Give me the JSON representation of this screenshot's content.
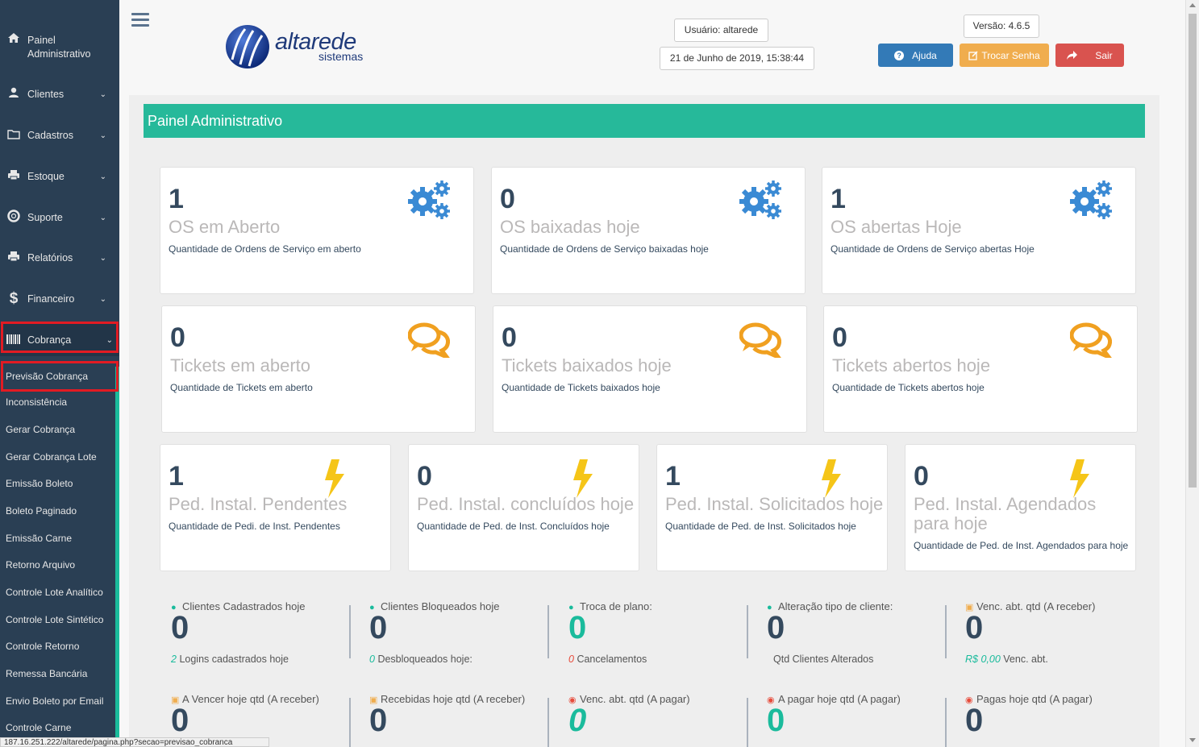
{
  "sidebar": {
    "home": "Painel Administrativo",
    "items": [
      {
        "label": "Clientes",
        "icon": "user-icon"
      },
      {
        "label": "Cadastros",
        "icon": "folder-icon"
      },
      {
        "label": "Estoque",
        "icon": "print-icon"
      },
      {
        "label": "Suporte",
        "icon": "lifebuoy-icon"
      },
      {
        "label": "Relatórios",
        "icon": "print-icon"
      },
      {
        "label": "Financeiro",
        "icon": "dollar-icon"
      },
      {
        "label": "Cobrança",
        "icon": "barcode-icon"
      }
    ],
    "subitems": [
      "Previsão Cobrança",
      "Inconsistência",
      "Gerar Cobrança",
      "Gerar Cobrança Lote",
      "Emissão Boleto",
      "Boleto Paginado",
      "Emissão Carne",
      "Retorno Arquivo",
      "Controle Lote Analítico",
      "Controle Lote Sintético",
      "Controle Retorno",
      "Remessa Bancária",
      "Envio Boleto por Email",
      "Controle Carne"
    ]
  },
  "header": {
    "logo_main": "altarede",
    "logo_sub": "sistemas",
    "user": "Usuário: altarede",
    "datetime": "21 de Junho de 2019, 15:38:44",
    "version": "Versão: 4.6.5",
    "help": "Ajuda",
    "change_password": "Trocar Senha",
    "logout": "Sair"
  },
  "panel": {
    "title": "Painel Administrativo"
  },
  "cards": [
    {
      "num": "1",
      "title": "OS em Aberto",
      "desc": "Quantidade de Ordens de Serviço em aberto"
    },
    {
      "num": "0",
      "title": "OS baixadas hoje",
      "desc": "Quantidade de Ordens de Serviço baixadas hoje"
    },
    {
      "num": "1",
      "title": "OS abertas Hoje",
      "desc": "Quantidade de Ordens de Serviço abertas Hoje"
    },
    {
      "num": "0",
      "title": "Tickets em aberto",
      "desc": "Quantidade de Tickets em aberto"
    },
    {
      "num": "0",
      "title": "Tickets baixados hoje",
      "desc": "Quantidade de Tickets baixados hoje"
    },
    {
      "num": "0",
      "title": "Tickets abertos hoje",
      "desc": "Quantidade de Tickets abertos hoje"
    },
    {
      "num": "1",
      "title": "Ped. Instal. Pendentes",
      "desc": "Quantidade de Pedi. de Inst. Pendentes"
    },
    {
      "num": "0",
      "title": "Ped. Instal. concluídos hoje",
      "desc": "Quantidade de Ped. de Inst. Concluídos hoje"
    },
    {
      "num": "1",
      "title": "Ped. Instal. Solicitados hoje",
      "desc": "Quantidade de Ped. de Inst. Solicitados hoje"
    },
    {
      "num": "0",
      "title": "Ped. Instal. Agendados para hoje",
      "desc": "Quantidade de Ped. de Inst. Agendados para hoje"
    }
  ],
  "stats": [
    {
      "label": "Clientes Cadastrados hoje",
      "num": "0",
      "sub_val": "2",
      "sub_text": "Logins cadastrados hoje"
    },
    {
      "label": "Clientes Bloqueados hoje",
      "num": "0",
      "sub_val": "0",
      "sub_text": "Desbloqueados hoje:"
    },
    {
      "label": "Troca de plano:",
      "num": "0",
      "sub_val": "0",
      "sub_text": "Cancelamentos"
    },
    {
      "label": "Alteração tipo de cliente:",
      "num": "0",
      "sub_val": "",
      "sub_text": "Qtd Clientes Alterados"
    },
    {
      "label": "Venc. abt. qtd (A receber)",
      "num": "0",
      "sub_val": "R$ 0,00",
      "sub_text": "Venc. abt."
    },
    {
      "label": "A Vencer hoje qtd (A receber)",
      "num": "0"
    },
    {
      "label": "Recebidas hoje qtd (A receber)",
      "num": "0"
    },
    {
      "label": "Venc. abt. qtd (A pagar)",
      "num": "0"
    },
    {
      "label": "A pagar hoje qtd (A pagar)",
      "num": "0"
    },
    {
      "label": "Pagas hoje qtd (A pagar)",
      "num": "0"
    }
  ],
  "status_url": "187.16.251.222/altarede/pagina.php?secao=previsao_cobranca",
  "colors": {
    "sidebar": "#2a3f54",
    "accent": "#26b99a",
    "danger": "#d9534f",
    "warning": "#f0ad4e",
    "primary": "#337ab7"
  }
}
